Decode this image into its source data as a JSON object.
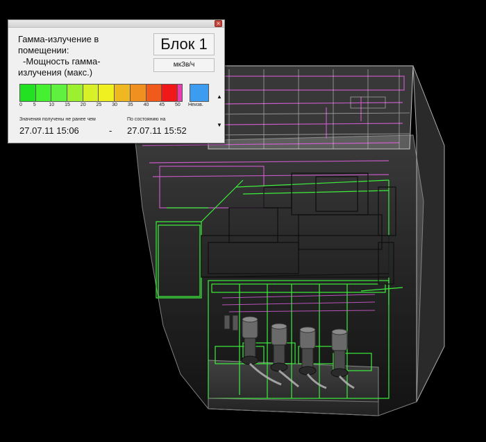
{
  "window": {
    "close_label": "×"
  },
  "info": {
    "title_line1": "Гамма-излучение в",
    "title_line2": "помещении:",
    "title_line3": "-Мощность гамма-",
    "title_line4": "излучения (макс.)",
    "block_name": "Блок 1",
    "unit": "мкЗв/ч"
  },
  "scale": {
    "colors": [
      "#22e022",
      "#44f030",
      "#60f040",
      "#9cf030",
      "#d8f028",
      "#f0f020",
      "#f0b820",
      "#f09020",
      "#f05a1a",
      "#f01818",
      "#e83cb0"
    ],
    "ticks": [
      "0",
      "5",
      "10",
      "15",
      "20",
      "25",
      "30",
      "35",
      "40",
      "45",
      "50"
    ],
    "unknown_color": "#3c9cf0",
    "unknown_label": "Неизв."
  },
  "time": {
    "from_label": "Значения получены не ранее чем",
    "asof_label": "По состоянию на",
    "from_value": "27.07.11 15:06",
    "dash": "-",
    "asof_value": "27.07.11 15:52"
  },
  "viewport": {
    "description_icon": "3d-building-model"
  }
}
